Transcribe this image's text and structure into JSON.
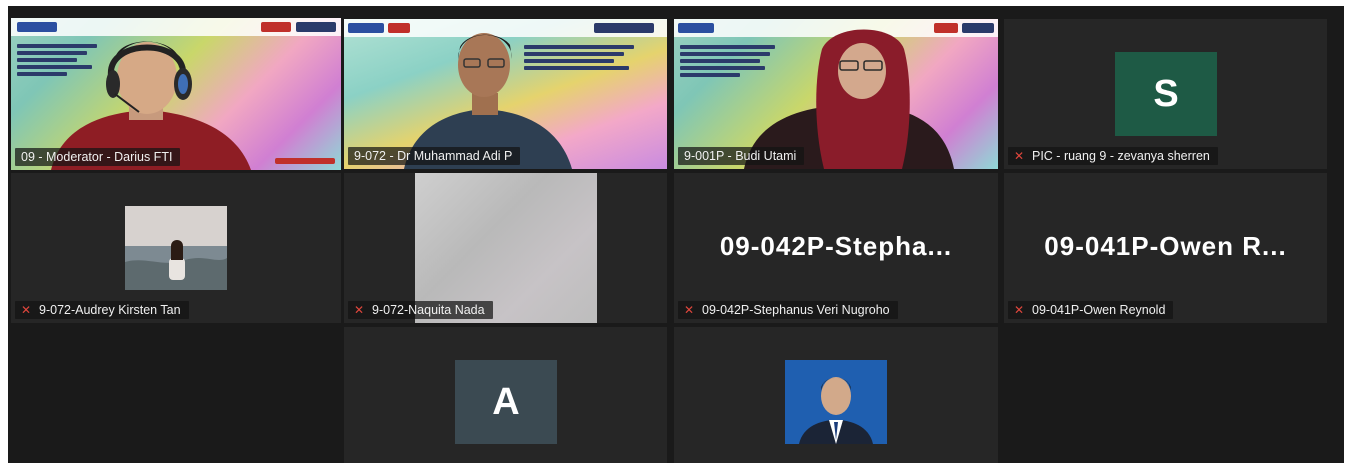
{
  "grid": {
    "tiles": [
      {
        "id": "moderator",
        "name": "09 - Moderator - Darius FTI",
        "muted": false,
        "type": "video",
        "active": true
      },
      {
        "id": "adi",
        "name": "9-072 - Dr Muhammad Adi P",
        "muted": false,
        "type": "video"
      },
      {
        "id": "budi",
        "name": "9-001P - Budi Utami",
        "muted": false,
        "type": "video"
      },
      {
        "id": "zevanya",
        "name": "PIC - ruang 9 - zevanya sherren",
        "muted": true,
        "type": "avatar",
        "initial": "S",
        "avatar_color": "#1e5a45"
      },
      {
        "id": "audrey",
        "name": "9-072-Audrey Kirsten Tan",
        "muted": true,
        "type": "photo"
      },
      {
        "id": "naquita",
        "name": "9-072-Naquita Nada",
        "muted": true,
        "type": "blank"
      },
      {
        "id": "stephanus",
        "name": "09-042P-Stephanus Veri Nugroho",
        "muted": true,
        "type": "text",
        "display": "09-042P-Stepha..."
      },
      {
        "id": "owen",
        "name": "09-041P-Owen Reynold",
        "muted": true,
        "type": "text",
        "display": "09-041P-Owen  R..."
      },
      {
        "id": "a-user",
        "type": "avatar",
        "initial": "A",
        "avatar_color": "#3b4a52"
      },
      {
        "id": "photo-user",
        "type": "photo"
      }
    ]
  },
  "colors": {
    "active_border": "#c8e06a",
    "mute_icon": "#e0463c",
    "tile_bg": "#262626"
  },
  "icons": {
    "mute": "mic-off-icon"
  }
}
